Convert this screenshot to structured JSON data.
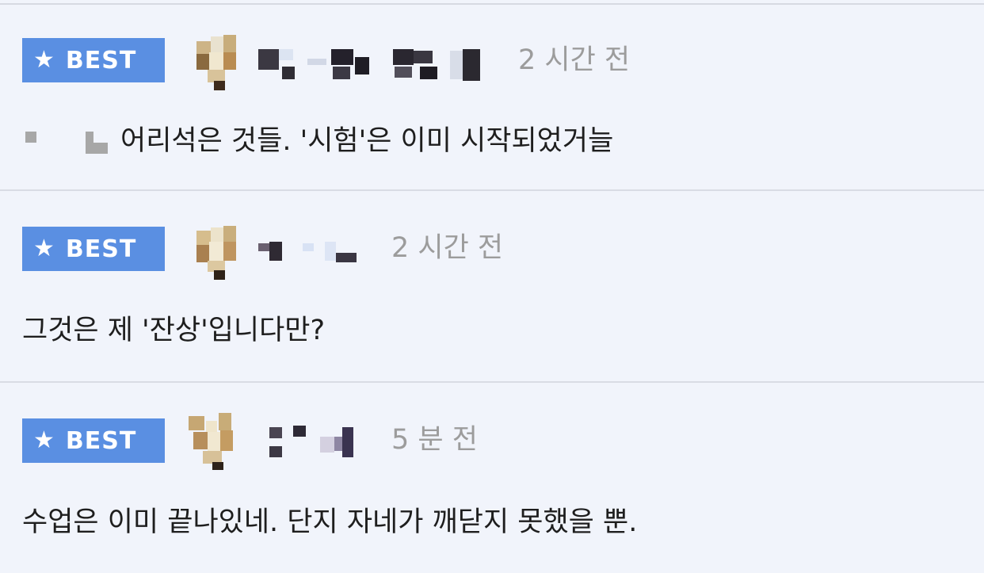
{
  "badge": {
    "label": "BEST",
    "icon": "star-icon",
    "color": "#5a8fe2"
  },
  "comments": [
    {
      "time": "2 시간 전",
      "text": "어리석은 것들. '시험'은 이미 시작되었거늘",
      "has_quote_marker": true
    },
    {
      "time": "2 시간 전",
      "text": "그것은 제 '잔상'입니다만?",
      "has_quote_marker": false
    },
    {
      "time": "5 분 전",
      "text": "수업은 이미 끝나있네. 단지 자네가 깨닫지 못했을 뿐.",
      "has_quote_marker": false
    }
  ]
}
